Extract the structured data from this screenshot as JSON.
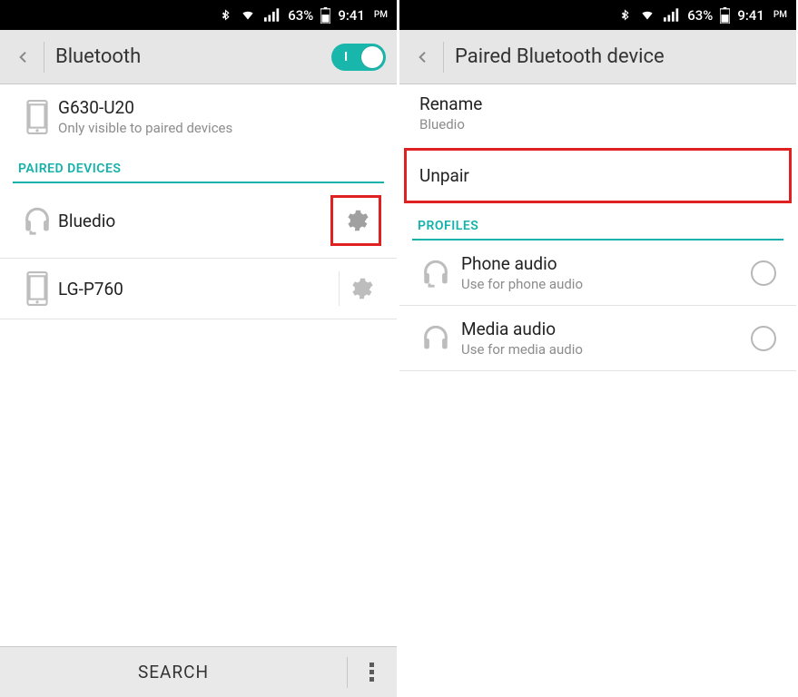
{
  "status": {
    "battery": "63%",
    "time": "9:41",
    "pm": "PM"
  },
  "left": {
    "title": "Bluetooth",
    "this_device": {
      "name": "G630-U20",
      "sub": "Only visible to paired devices"
    },
    "paired_label": "PAIRED DEVICES",
    "devices": [
      {
        "name": "Bluedio"
      },
      {
        "name": "LG-P760"
      }
    ],
    "search_label": "SEARCH"
  },
  "right": {
    "title": "Paired Bluetooth device",
    "rename": {
      "label": "Rename",
      "value": "Bluedio"
    },
    "unpair_label": "Unpair",
    "profiles_label": "PROFILES",
    "profiles": [
      {
        "title": "Phone audio",
        "sub": "Use for phone audio"
      },
      {
        "title": "Media audio",
        "sub": "Use for media audio"
      }
    ]
  }
}
